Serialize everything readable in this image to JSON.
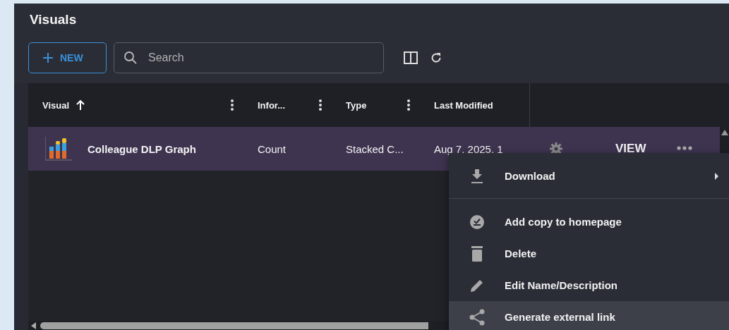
{
  "title": "Visuals",
  "toolbar": {
    "new_button": "NEW",
    "search": {
      "placeholder": "Search"
    }
  },
  "table": {
    "columns": [
      {
        "label": "Visual",
        "sorted": true,
        "menu": true
      },
      {
        "label": "Infor...",
        "sorted": false,
        "menu": true
      },
      {
        "label": "Type",
        "sorted": false,
        "menu": true
      },
      {
        "label": "Last Modified",
        "sorted": false,
        "menu": false
      }
    ],
    "rows": [
      {
        "selected": true,
        "visual": "Colleague DLP Graph",
        "information": "Count",
        "type": "Stacked C...",
        "last_modified": "Aug 7, 2025, 1",
        "action": "VIEW"
      }
    ]
  },
  "context_menu": {
    "items": [
      {
        "kind": "download",
        "label": "Download",
        "submenu": true,
        "highlighted": false
      },
      {
        "kind": "divider"
      },
      {
        "kind": "homepage",
        "label": "Add copy to homepage",
        "submenu": false,
        "highlighted": false
      },
      {
        "kind": "delete",
        "label": "Delete",
        "submenu": false,
        "highlighted": false
      },
      {
        "kind": "edit",
        "label": "Edit Name/Description",
        "submenu": false,
        "highlighted": false
      },
      {
        "kind": "share",
        "label": "Generate external link",
        "submenu": false,
        "highlighted": true
      }
    ]
  }
}
